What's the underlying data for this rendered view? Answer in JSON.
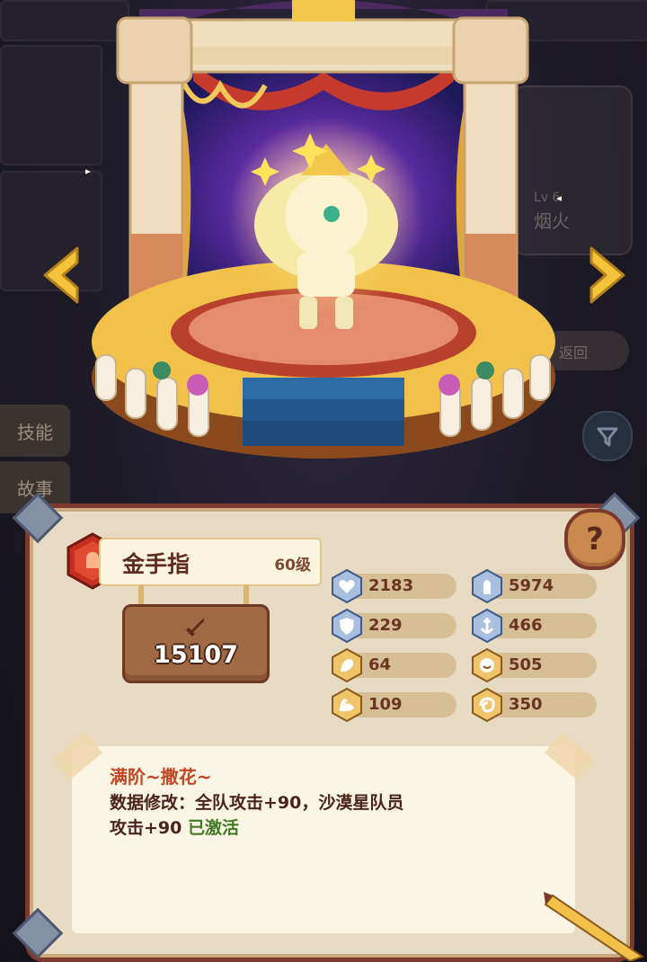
{
  "side_tabs": [
    {
      "label": "技能"
    },
    {
      "label": "故事"
    }
  ],
  "background_card": {
    "level": "Lv 6",
    "name": "烟火"
  },
  "background_button": {
    "label": "返回"
  },
  "cookie": {
    "name": "金手指",
    "level": "60级",
    "power": "15107"
  },
  "stats": {
    "health": "2183",
    "attack": "5974",
    "defense": "229",
    "crit": "466",
    "stat3": "64",
    "stat4": "505",
    "stat5": "109",
    "stat6": "350"
  },
  "help_label": "?",
  "description": {
    "title": "满阶~撒花~",
    "line1": "数据修改：全队攻击+90，沙漠星队员",
    "line2_prefix": "攻击+90 ",
    "line2_status": "已激活"
  },
  "colors": {
    "panel_border": "#7d3a2c",
    "title_red": "#c04624",
    "active_green": "#3f7a22",
    "stat_bar": "#d7bf95"
  }
}
